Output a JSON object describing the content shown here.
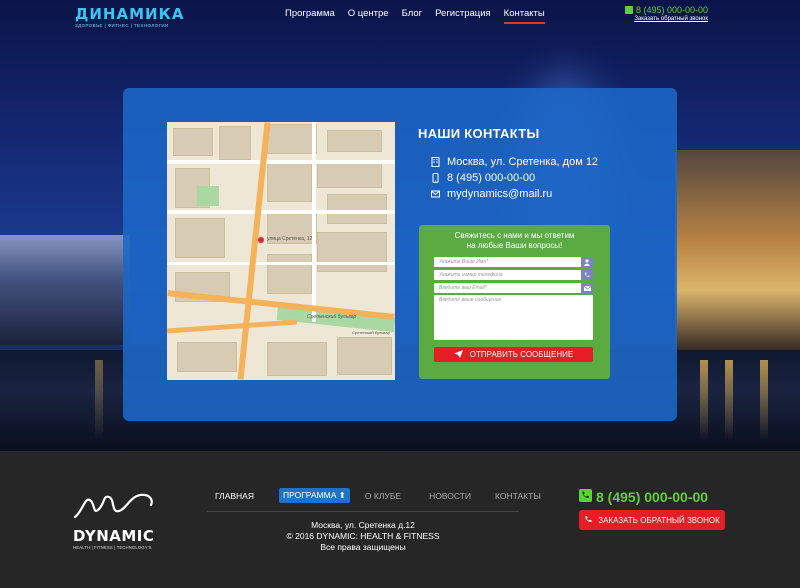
{
  "header": {
    "logo_title": "ДИНАМИКА",
    "logo_subtitle": "ЗДОРОВЬЕ | ФИТНЕС | ТЕХНОЛОГИИ",
    "nav": [
      "Программа",
      "О центре",
      "Блог",
      "Регистрация",
      "Контакты"
    ],
    "active_nav": "Контакты",
    "phone": "8 (495) 000-00-00",
    "callback_link": "Заказать обратный звонок"
  },
  "contacts": {
    "title": "НАШИ КОНТАКТЫ",
    "address": "Москва, ул. Сретенка, дом 12",
    "phone": "8 (495) 000-00-00",
    "email": "mydynamics@mail.ru",
    "map_labels": [
      "улица Сретенка, 12",
      "Сретенский бульвар",
      "Сретенский бульвар"
    ]
  },
  "form": {
    "heading_line1": "Свяжитесь с нами и мы ответим",
    "heading_line2": "на любые Ваши вопросы!",
    "name_placeholder": "Укажите Ваше Имя*",
    "phone_placeholder": "Укажите номер телефона",
    "email_placeholder": "Введите ваш Email*",
    "message_placeholder": "Введите ваше сообщение",
    "submit_label": "ОТПРАВИТЬ СООБЩЕНИЕ"
  },
  "footer": {
    "logo_title": "DYNAMIC",
    "logo_subtitle": "HEALTH | FITNESS | TECHNOLOGY'S",
    "nav": [
      "ГЛАВНАЯ",
      "ПРОГРАММА",
      "О КЛУБЕ",
      "НОВОСТИ",
      "КОНТАКТЫ"
    ],
    "address": "Москва, ул. Сретенка д.12",
    "copyright": "© 2016 DYNAMIC: HEALTH & FITNESS",
    "rights": "Все права защищены",
    "phone": "8 (495) 000-00-00",
    "callback_button": "ЗАКАЗАТЬ ОБРАТНЫЙ ЗВОНОК"
  },
  "colors": {
    "accent_red": "#e31e24",
    "accent_green": "#5bab43",
    "phone_green": "#5fcf3e",
    "card_blue": "#1c68c8",
    "logo_cyan": "#3ac4f0"
  }
}
